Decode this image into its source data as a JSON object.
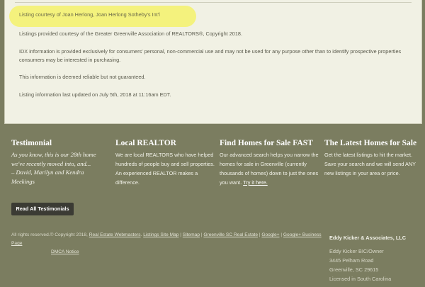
{
  "disclaimer": {
    "courtesy": "Listing courtesy of Joan Herlong, Joan Herlong Sotheby's Int'l",
    "provided": "Listings provided courtesy of the Greater Greenville Association of REALTORS®, Copyright 2018.",
    "idx": "IDX information is provided exclusively for consumers' personal, non-commercial use and may not be used for any purpose other than to identify prospective properties consumers may be interested in purchasing.",
    "reliable": "This information is deemed reliable but not guaranteed.",
    "updated": "Listing information last updated on July 5th, 2018 at 11:16am EDT."
  },
  "footer": {
    "testimonial": {
      "title": "Testimonial",
      "quote": "As you know, this is our 28th home we've recently moved into, and...",
      "author": "– David, Marilyn and Kendra Meekings",
      "button": "Read All Testimonials"
    },
    "local": {
      "title": "Local REALTOR",
      "text": "We are local REALTORS who have helped hundreds of people buy and sell properties. An experienced REALTOR makes a difference."
    },
    "find": {
      "title": "Find Homes for Sale FAST",
      "text": "Our advanced search helps you narrow the homes for sale in Greenville (currently thousands of homes) down to just the ones you want.",
      "link": "Try it here."
    },
    "latest": {
      "title": "The Latest Homes for Sale",
      "text": "Get the latest listings to hit the market. Save your search and we will send ANY new listings in your area or price."
    },
    "legal": {
      "prefix": "All rights reserved.© Copyright 2018,",
      "links": [
        "Real Estate Webmasters",
        "Listings Site Map",
        "Sitemap",
        "Greenville SC Real Estate",
        "Google+",
        "Google+ Business Page",
        "DMCA Notice"
      ]
    },
    "contact": {
      "company": "Eddy Kicker & Associates, LLC",
      "name": "Eddy Kicker BIC/Owner",
      "street": "3445 Pelham Road",
      "city": "Greenville, SC 29615",
      "license": "Licensed in South Carolina"
    }
  }
}
